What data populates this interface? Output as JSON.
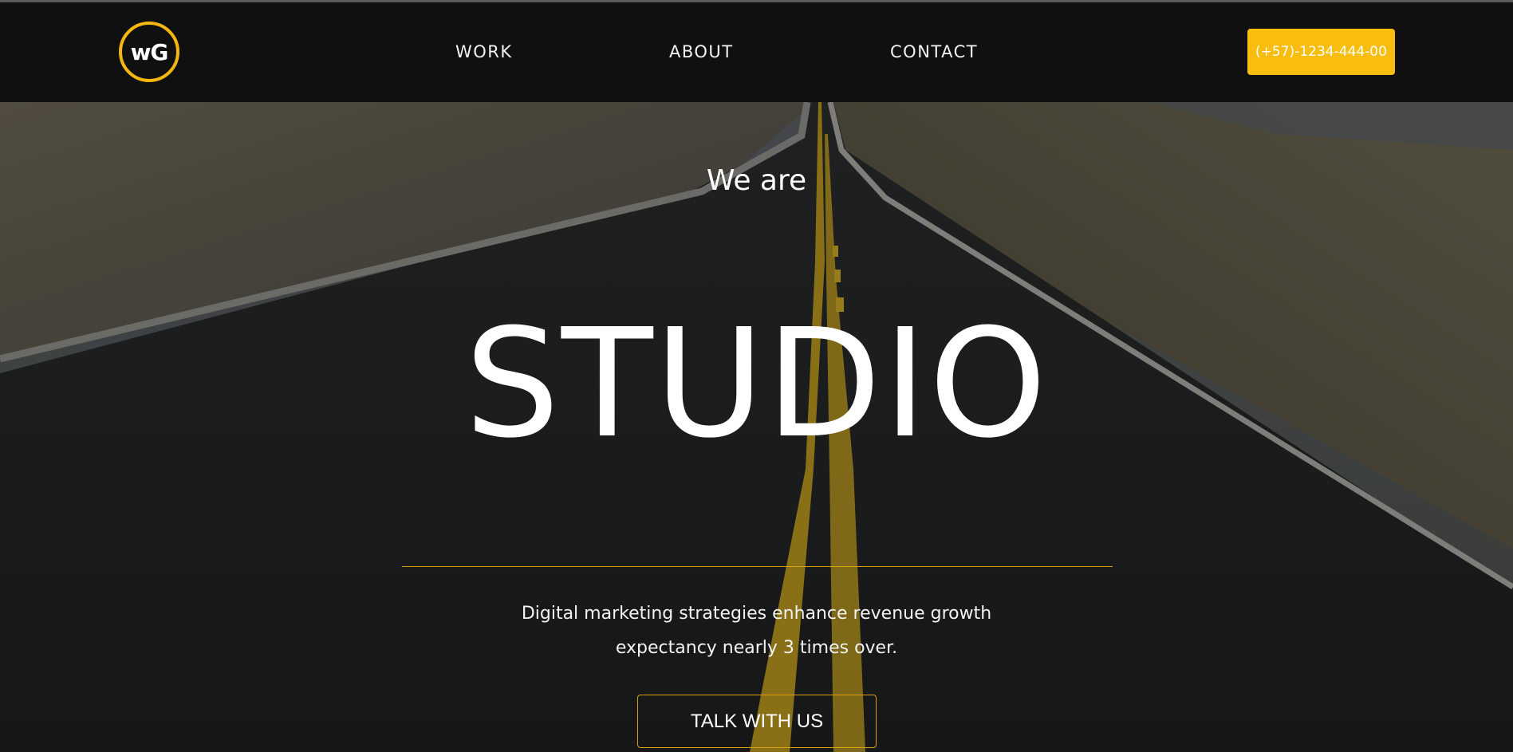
{
  "header": {
    "logo_text": "wG",
    "nav": [
      "WORK",
      "ABOUT",
      "CONTACT"
    ],
    "phone": "(+57)-1234-444-00"
  },
  "hero": {
    "kicker": "We are",
    "headline": "STUDIO",
    "tagline_line1": "Digital marketing strategies enhance revenue growth",
    "tagline_line2": "expectancy nearly 3 times over.",
    "cta": "TALK WITH US"
  },
  "colors": {
    "accent": "#f9bd10",
    "header_bg": "#101010",
    "text": "#ffffff"
  },
  "icons": [
    "logo-icon"
  ]
}
